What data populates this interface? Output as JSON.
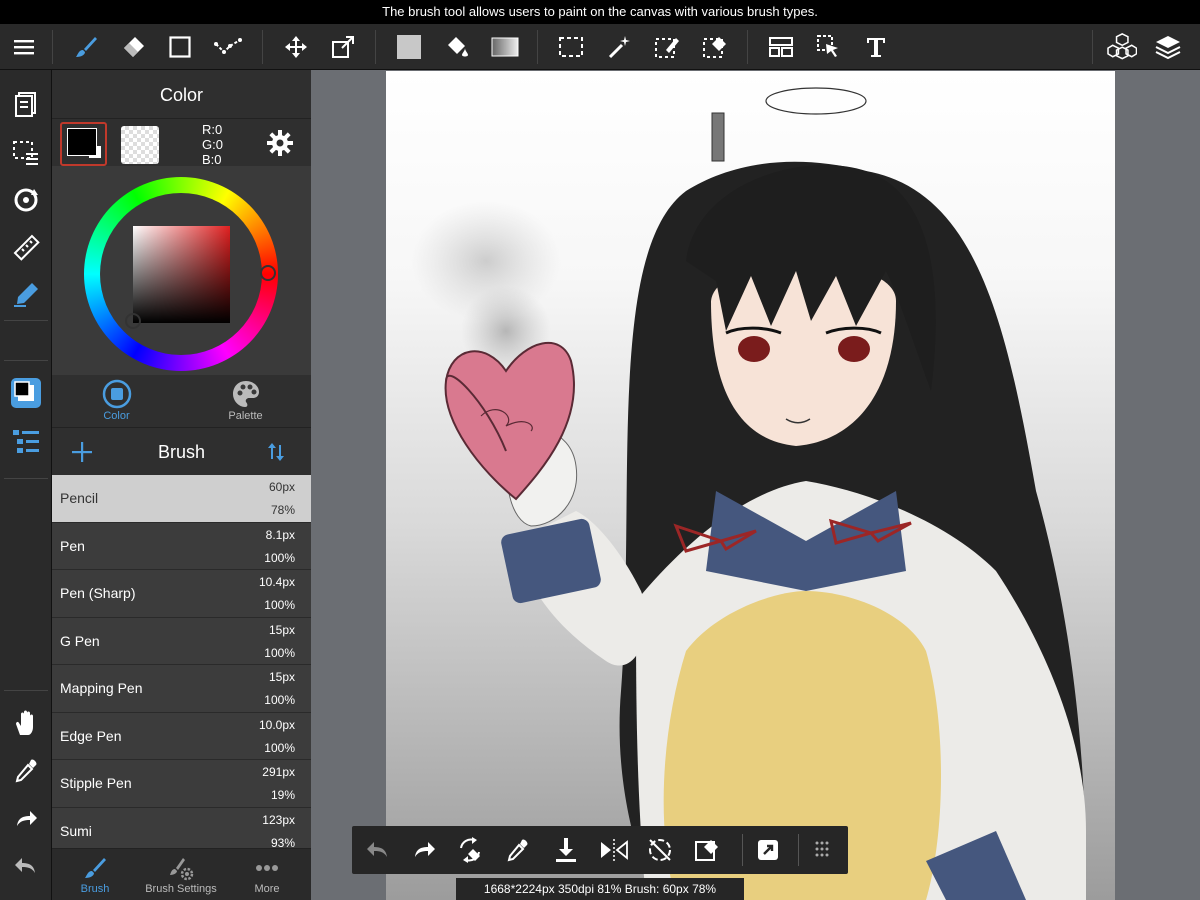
{
  "banner": {
    "text": "The brush tool allows users to paint on the canvas with various brush types."
  },
  "toolbar": {
    "tools": [
      "menu",
      "brush",
      "eraser",
      "shape",
      "select-lasso",
      "move",
      "transform",
      "fill-color",
      "bucket",
      "gradient",
      "select-rect",
      "magic-wand",
      "select-pen",
      "select-eraser",
      "frame-divider",
      "operation",
      "text",
      "material",
      "layers"
    ]
  },
  "color_panel": {
    "title": "Color",
    "rgb": {
      "r": "R:0",
      "g": "G:0",
      "b": "B:0"
    },
    "fg_color": "#000000",
    "bg_color": "#ffffff",
    "tabs": [
      {
        "label": "Color",
        "active": true
      },
      {
        "label": "Palette",
        "active": false
      }
    ]
  },
  "brush_panel": {
    "title": "Brush",
    "items": [
      {
        "name": "Pencil",
        "size": "60px",
        "opacity": "78%",
        "selected": true
      },
      {
        "name": "Pen",
        "size": "8.1px",
        "opacity": "100%"
      },
      {
        "name": "Pen (Sharp)",
        "size": "10.4px",
        "opacity": "100%"
      },
      {
        "name": "G Pen",
        "size": "15px",
        "opacity": "100%"
      },
      {
        "name": "Mapping Pen",
        "size": "15px",
        "opacity": "100%"
      },
      {
        "name": "Edge Pen",
        "size": "10.0px",
        "opacity": "100%"
      },
      {
        "name": "Stipple Pen",
        "size": "291px",
        "opacity": "19%"
      },
      {
        "name": "Sumi",
        "size": "123px",
        "opacity": "93%"
      }
    ]
  },
  "bottom_tabs": [
    {
      "label": "Brush",
      "active": true
    },
    {
      "label": "Brush Settings",
      "active": false
    },
    {
      "label": "More",
      "active": false
    }
  ],
  "status": {
    "text": "1668*2224px 350dpi 81% Brush: 60px 78%"
  },
  "accent_color": "#4a9de0"
}
